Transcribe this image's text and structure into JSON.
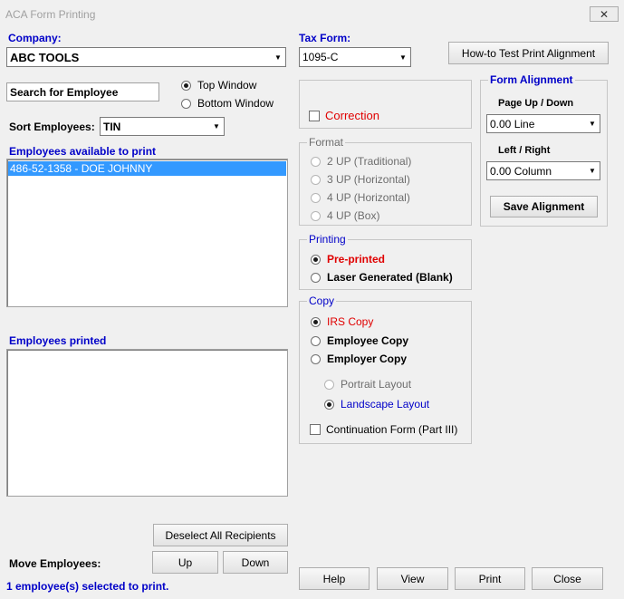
{
  "window": {
    "title": "ACA Form Printing",
    "close_label": "✕"
  },
  "company": {
    "label": "Company:",
    "value": "ABC TOOLS"
  },
  "tax_form": {
    "label": "Tax Form:",
    "value": "1095-C"
  },
  "test_print_button": "How-to Test Print Alignment",
  "search": {
    "value": "Search for Employee"
  },
  "window_choice": {
    "top": "Top Window",
    "bottom": "Bottom Window",
    "selected": "top"
  },
  "sort": {
    "label": "Sort Employees:",
    "value": "TIN"
  },
  "available": {
    "label": "Employees available to print",
    "items": [
      "486-52-1358 - DOE JOHNNY"
    ]
  },
  "printed": {
    "label": "Employees printed",
    "items": []
  },
  "correction": {
    "label": "Correction",
    "checked": false
  },
  "format": {
    "title": "Format",
    "options": [
      "2 UP (Traditional)",
      "3 UP (Horizontal)",
      "4 UP (Horizontal)",
      "4 UP (Box)"
    ]
  },
  "printing": {
    "title": "Printing",
    "pre_printed": "Pre-printed",
    "laser": "Laser Generated (Blank)",
    "selected": "pre_printed"
  },
  "copy": {
    "title": "Copy",
    "irs": "IRS Copy",
    "employee": "Employee Copy",
    "employer": "Employer Copy",
    "portrait": "Portrait Layout",
    "landscape": "Landscape Layout",
    "continuation": "Continuation Form (Part III)",
    "selected": "irs",
    "layout_selected": "landscape"
  },
  "alignment": {
    "title": "Form Alignment",
    "page_label": "Page Up / Down",
    "page_value": "0.00 Line",
    "lr_label": "Left / Right",
    "lr_value": "0.00 Column",
    "save_button": "Save  Alignment"
  },
  "deselect_button": "Deselect  All Recipients",
  "move": {
    "label": "Move Employees:",
    "up": "Up",
    "down": "Down"
  },
  "status_text": "1 employee(s) selected to print.",
  "actions": {
    "help": "Help",
    "view": "View",
    "print": "Print",
    "close": "Close"
  },
  "colors": {
    "label_blue": "#0000c8",
    "alert_red": "#e00000",
    "selection": "#3399ff"
  }
}
